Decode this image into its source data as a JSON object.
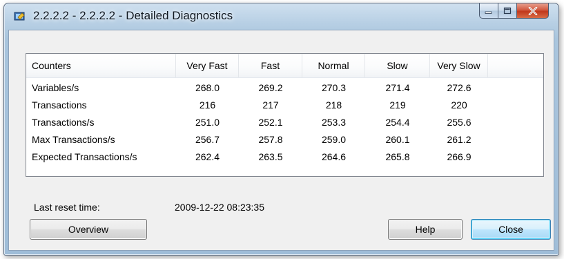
{
  "window": {
    "title": "2.2.2.2 - 2.2.2.2 - Detailed Diagnostics"
  },
  "icons": {
    "app": "diagnostics-app-icon",
    "minimize": "minimize-icon",
    "maximize": "maximize-icon",
    "close": "close-x-icon"
  },
  "table": {
    "columns": [
      "Counters",
      "Very Fast",
      "Fast",
      "Normal",
      "Slow",
      "Very Slow"
    ],
    "rows": [
      [
        "Variables/s",
        "268.0",
        "269.2",
        "270.3",
        "271.4",
        "272.6"
      ],
      [
        "Transactions",
        "216",
        "217",
        "218",
        "219",
        "220"
      ],
      [
        "Transactions/s",
        "251.0",
        "252.1",
        "253.3",
        "254.4",
        "255.6"
      ],
      [
        "Max Transactions/s",
        "256.7",
        "257.8",
        "259.0",
        "260.1",
        "261.2"
      ],
      [
        "Expected Transactions/s",
        "262.4",
        "263.5",
        "264.6",
        "265.8",
        "266.9"
      ]
    ]
  },
  "reset": {
    "label": "Last reset time:",
    "value": "2009-12-22 08:23:35"
  },
  "buttons": {
    "overview": "Overview",
    "help": "Help",
    "close": "Close"
  }
}
